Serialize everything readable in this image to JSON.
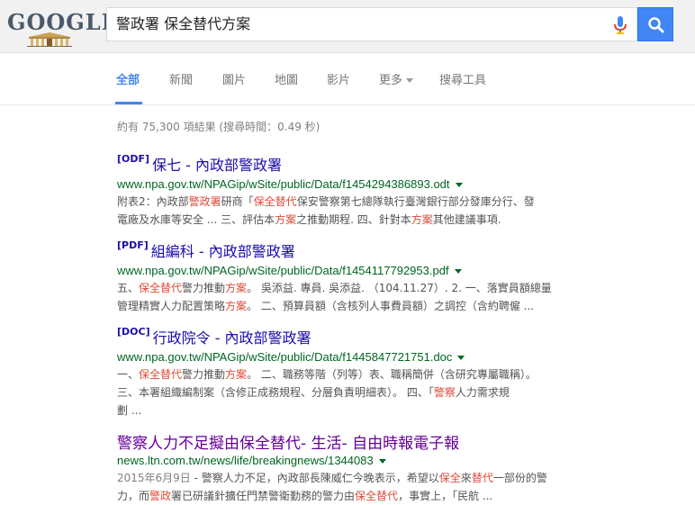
{
  "logo": {
    "text": "GOOGLE"
  },
  "search": {
    "query": "警政署 保全替代方案"
  },
  "tabs": [
    {
      "label": "全部"
    },
    {
      "label": "新聞"
    },
    {
      "label": "圖片"
    },
    {
      "label": "地圖"
    },
    {
      "label": "影片"
    },
    {
      "label": "更多"
    },
    {
      "label": "搜尋工具"
    }
  ],
  "stats": "約有 75,300 項結果 (搜尋時間：0.49 秒)",
  "results": [
    {
      "type": "[ODF]",
      "title": "保七 - 內政部警政署",
      "url": "www.npa.gov.tw/NPAGip/wSite/public/Data/f1454294386893.odt",
      "snippet": [
        [
          {
            "t": "附表2：內政部"
          },
          {
            "t": "警政署",
            "h": true
          },
          {
            "t": "研商「"
          },
          {
            "t": "保全替代",
            "h": true
          },
          {
            "t": "保安警察第七總隊執行臺灣銀行部分發庫分行、發"
          }
        ],
        [
          {
            "t": "電廠及水庫等安全 ... 三、評估本"
          },
          {
            "t": "方案",
            "h": true
          },
          {
            "t": "之推動期程. 四、針對本"
          },
          {
            "t": "方案",
            "h": true
          },
          {
            "t": "其他建議事項."
          }
        ]
      ]
    },
    {
      "type": "[PDF]",
      "title": "組編科 - 內政部警政署",
      "url": "www.npa.gov.tw/NPAGip/wSite/public/Data/f1454117792953.pdf",
      "snippet": [
        [
          {
            "t": "五、"
          },
          {
            "t": "保全替代",
            "h": true
          },
          {
            "t": "警力推動"
          },
          {
            "t": "方案",
            "h": true
          },
          {
            "t": "。 吳添益. 專員. 吳添益. （104.11.27）. 2. 一、落實員額總量"
          }
        ],
        [
          {
            "t": "管理精實人力配置策略"
          },
          {
            "t": "方案",
            "h": true
          },
          {
            "t": "。 二、預算員額（含核列人事費員額）之調控（含約聘僱 ..."
          }
        ]
      ]
    },
    {
      "type": "[DOC]",
      "title": "行政院令 - 內政部警政署",
      "url": "www.npa.gov.tw/NPAGip/wSite/public/Data/f1445847721751.doc",
      "snippet": [
        [
          {
            "t": "一、"
          },
          {
            "t": "保全替代",
            "h": true
          },
          {
            "t": "警力推動"
          },
          {
            "t": "方案",
            "h": true
          },
          {
            "t": "。 二、職務等階（列等）表、職稱簡併（含研究專屬職稱）。"
          }
        ],
        [
          {
            "t": "三、本署組織編制案（含修正成務規程、分層負責明細表）。 四、「"
          },
          {
            "t": "警察",
            "h": true
          },
          {
            "t": "人力需求規"
          }
        ],
        [
          {
            "t": "劃 ..."
          }
        ]
      ]
    },
    {
      "type": "",
      "title": "警察人力不足擬由保全替代- 生活- 自由時報電子報",
      "url": "news.ltn.com.tw/news/life/breakingnews/1344083",
      "snippet": [
        [
          {
            "t": "2015年6月9日",
            "d": true
          },
          {
            "t": " - 警察人力不足，內政部長陳威仁今晚表示，希望以"
          },
          {
            "t": "保全",
            "h": true
          },
          {
            "t": "來"
          },
          {
            "t": "替代",
            "h": true
          },
          {
            "t": "一部份的警"
          }
        ],
        [
          {
            "t": "力，而"
          },
          {
            "t": "警政",
            "h": true
          },
          {
            "t": "署已研議針擴任門禁警衛勤務的警力由"
          },
          {
            "t": "保全替代",
            "h": true
          },
          {
            "t": "，事實上，「民航 ..."
          }
        ]
      ]
    }
  ],
  "colors": {
    "link": "#1a0dab",
    "visited": "#660099",
    "url": "#006621",
    "highlight": "#dd4b39",
    "accent": "#4285f4"
  }
}
